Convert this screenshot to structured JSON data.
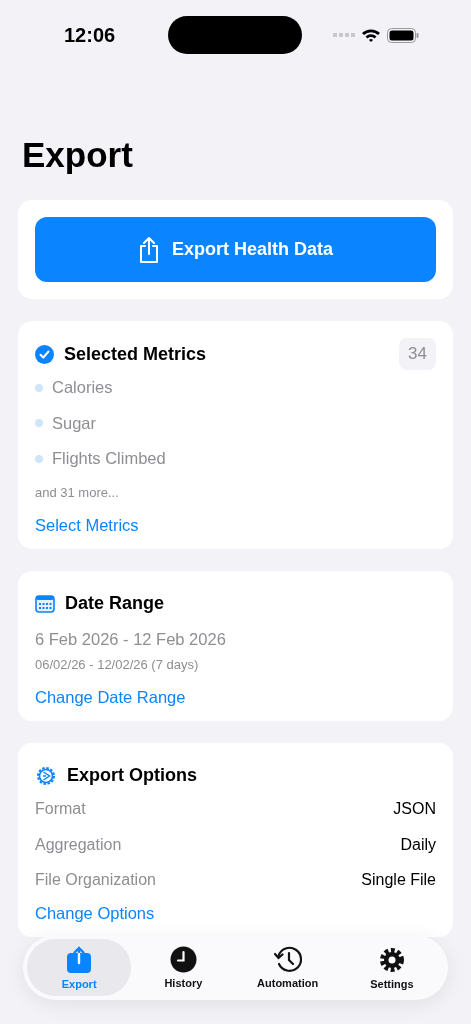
{
  "status_bar": {
    "time": "12:06"
  },
  "title": "Export",
  "export_button": {
    "label": "Export Health Data"
  },
  "selected_metrics": {
    "title": "Selected Metrics",
    "count": "34",
    "items": [
      "Calories",
      "Sugar",
      "Flights Climbed"
    ],
    "more": "and 31 more...",
    "link": "Select Metrics"
  },
  "date_range": {
    "title": "Date Range",
    "range": "6 Feb 2026 - 12 Feb 2026",
    "short": "06/02/26 - 12/02/26 (7 days)",
    "link": "Change Date Range"
  },
  "export_options": {
    "title": "Export Options",
    "rows": [
      {
        "label": "Format",
        "value": "JSON"
      },
      {
        "label": "Aggregation",
        "value": "Daily"
      },
      {
        "label": "File Organization",
        "value": "Single File"
      }
    ],
    "link": "Change Options"
  },
  "tab_bar": [
    {
      "kind": "export",
      "label": "Export",
      "selected": true
    },
    {
      "kind": "history",
      "label": "History",
      "selected": false
    },
    {
      "kind": "automation",
      "label": "Automation",
      "selected": false
    },
    {
      "kind": "settings",
      "label": "Settings",
      "selected": false
    }
  ]
}
